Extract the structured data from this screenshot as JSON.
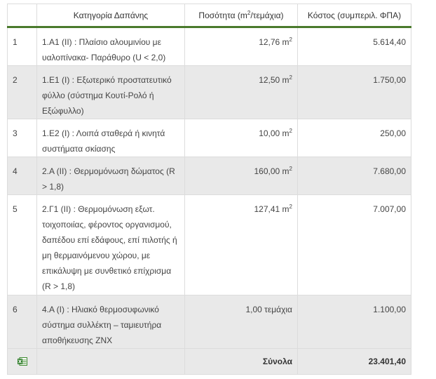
{
  "table": {
    "headers": {
      "index": "",
      "category": "Κατηγορία Δαπάνης",
      "quantity_prefix": "Ποσότητα (m",
      "quantity_sup": "2",
      "quantity_suffix": "/τεμάχια)",
      "cost": "Κόστος (συμπεριλ. ΦΠΑ)"
    },
    "rows": [
      {
        "index": "1",
        "category": "1.Α1 (ΙΙ) : Πλαίσιο αλουμινίου με υαλοπίνακα- Παράθυρο (U < 2,0)",
        "quantity": "12,76 m",
        "unit_sup": "2",
        "cost": "5.614,40"
      },
      {
        "index": "2",
        "category": "1.Ε1 (Ι) : Εξωτερικό προστατευτικό φύλλο (σύστημα Κουτί-Ρολό ή Εξώφυλλο)",
        "quantity": "12,50 m",
        "unit_sup": "2",
        "cost": "1.750,00"
      },
      {
        "index": "3",
        "category": "1.Ε2 (Ι) : Λοιπά σταθερά ή κινητά συστήματα σκίασης",
        "quantity": "10,00 m",
        "unit_sup": "2",
        "cost": "250,00"
      },
      {
        "index": "4",
        "category": "2.Α (ΙΙ) : Θερμομόνωση δώματος (R > 1,8)",
        "quantity": "160,00 m",
        "unit_sup": "2",
        "cost": "7.680,00"
      },
      {
        "index": "5",
        "category": "2.Γ1 (ΙΙ) : Θερμομόνωση εξωτ. τοιχοποιίας, φέροντος οργανισμού, δαπέδου επί εδάφους, επί πιλοτής ή μη θερμαινόμενου χώρου, με επικάλυψη με συνθετικό επίχρισμα (R > 1,8)",
        "quantity": "127,41 m",
        "unit_sup": "2",
        "cost": "7.007,00"
      },
      {
        "index": "6",
        "category": "4.Α (Ι) : Ηλιακό θερμοσυφωνικό σύστημα συλλέκτη – ταμιευτήρα αποθήκευσης ΖΝΧ",
        "quantity": "1,00 τεμάχια",
        "unit_sup": "",
        "cost": "1.100,00"
      }
    ],
    "footer": {
      "icon": "excel-export-icon",
      "total_label": "Σύνολα",
      "total_value": "23.401,40"
    }
  }
}
